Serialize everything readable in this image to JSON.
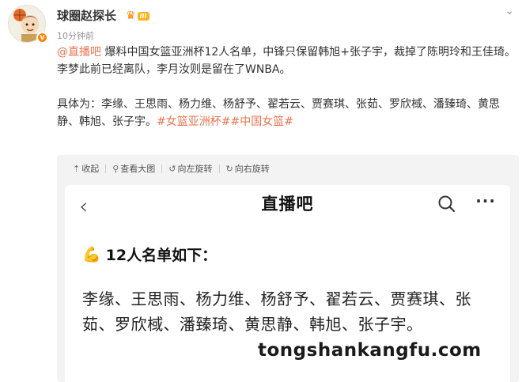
{
  "post": {
    "username": "球圈赵探长",
    "badge_level": "III",
    "timestamp": "10分钟前",
    "mention": "@直播吧",
    "line1": " 爆料中国女篮亚洲杯12人名单，中锋只保留韩旭+张子宇，裁掉了陈明玲和王佳琦。李梦此前已经离队，李月汝则是留在了WNBA。",
    "line2": "具体为：李缘、王思雨、杨力维、杨舒予、翟若云、贾赛琪、张茹、罗欣棫、潘臻琦、黄思静、韩旭、张子宇。",
    "hashtags": "#女篮亚洲杯##中国女篮#"
  },
  "toolbar": {
    "collapse": "收起",
    "view_large": "查看大图",
    "rotate_left": "向左旋转",
    "rotate_right": "向右旋转"
  },
  "screenshot": {
    "title": "直播吧",
    "heading": "12人名单如下：",
    "names": "李缘、王思雨、杨力维、杨舒予、翟若云、贾赛琪、张茹、罗欣棫、潘臻琦、黄思静、韩旭、张子宇。"
  },
  "watermark": "tongshankangfu.com"
}
